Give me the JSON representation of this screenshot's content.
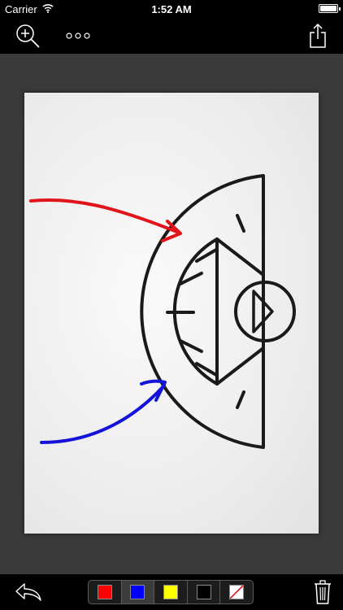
{
  "status_bar": {
    "carrier": "Carrier",
    "time": "1:52 AM"
  },
  "toolbar": {
    "zoom_icon": "zoom-in-icon",
    "more_icon": "more-icon",
    "share_icon": "share-icon"
  },
  "palette": {
    "selected_index": 1,
    "swatches": [
      {
        "name": "red",
        "color": "#ff0000"
      },
      {
        "name": "blue",
        "color": "#0000ff"
      },
      {
        "name": "yellow",
        "color": "#ffff00"
      },
      {
        "name": "black",
        "color": "#000000"
      },
      {
        "name": "no-color",
        "color": "none"
      }
    ]
  },
  "drawing": {
    "line_color": "#1a1a1a",
    "arrow_colors": [
      "#e0141a",
      "#1414d8"
    ]
  },
  "bottom_bar": {
    "undo_icon": "undo-icon",
    "trash_icon": "trash-icon"
  }
}
